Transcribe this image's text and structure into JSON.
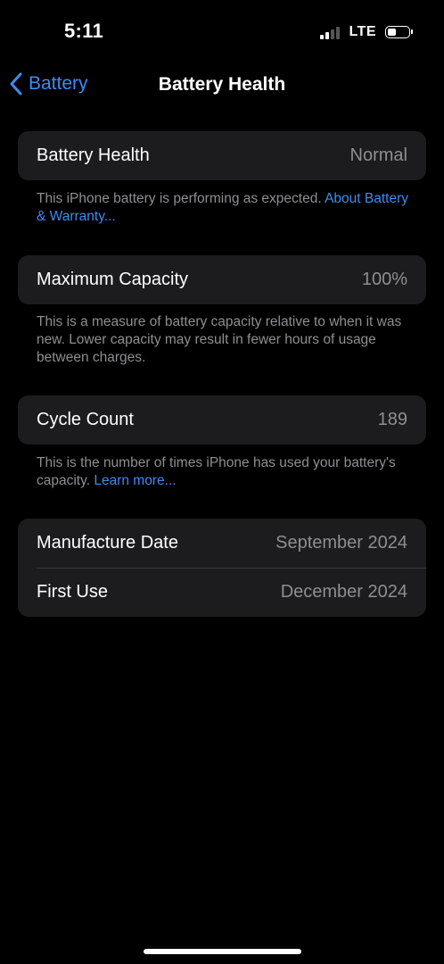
{
  "status_bar": {
    "time": "5:11",
    "network": "LTE",
    "signal_icon": "signal-bars-icon",
    "battery_icon": "battery-icon"
  },
  "nav": {
    "back_label": "Battery",
    "back_icon": "chevron-left-icon",
    "title": "Battery Health"
  },
  "health": {
    "label": "Battery Health",
    "value": "Normal",
    "footnote_text": "This iPhone battery is performing as expected. ",
    "footnote_link": "About Battery & Warranty..."
  },
  "capacity": {
    "label": "Maximum Capacity",
    "value": "100%",
    "footnote_text": "This is a measure of battery capacity relative to when it was new. Lower capacity may result in fewer hours of usage between charges."
  },
  "cycles": {
    "label": "Cycle Count",
    "value": "189",
    "footnote_text": "This is the number of times iPhone has used your battery's capacity. ",
    "footnote_link": "Learn more..."
  },
  "dates": {
    "manufacture_label": "Manufacture Date",
    "manufacture_value": "September 2024",
    "first_use_label": "First Use",
    "first_use_value": "December 2024"
  },
  "colors": {
    "accent": "#3d8bf2",
    "background": "#000000",
    "cell": "#1c1c1e",
    "secondary_text": "#8e8e93"
  }
}
